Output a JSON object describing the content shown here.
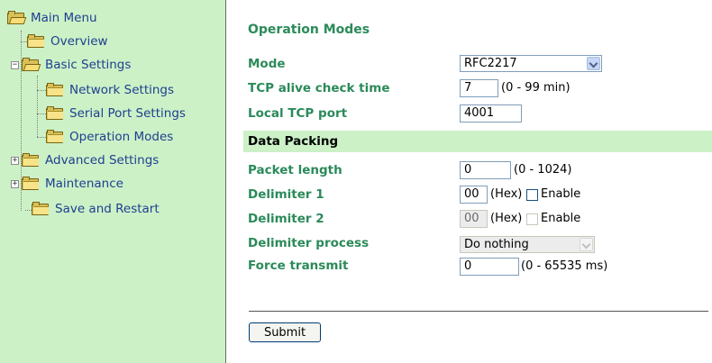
{
  "sidebar": {
    "items": [
      {
        "label": "Main Menu"
      },
      {
        "label": "Overview"
      },
      {
        "label": "Basic Settings"
      },
      {
        "label": "Network Settings"
      },
      {
        "label": "Serial Port Settings"
      },
      {
        "label": "Operation Modes"
      },
      {
        "label": "Advanced Settings"
      },
      {
        "label": "Maintenance"
      },
      {
        "label": "Save and Restart"
      }
    ]
  },
  "main": {
    "title": "Operation Modes",
    "mode": {
      "label": "Mode",
      "value": "RFC2217"
    },
    "tcp_alive": {
      "label": "TCP alive check time",
      "value": "7",
      "hint": "(0 - 99 min)"
    },
    "local_tcp_port": {
      "label": "Local TCP port",
      "value": "4001"
    },
    "data_packing": {
      "label": "Data Packing"
    },
    "packet_length": {
      "label": "Packet length",
      "value": "0",
      "hint": "(0 - 1024)"
    },
    "delimiter1": {
      "label": "Delimiter 1",
      "value": "00",
      "hint": "(Hex)",
      "enable_label": "Enable",
      "enabled": false
    },
    "delimiter2": {
      "label": "Delimiter 2",
      "value": "00",
      "hint": "(Hex)",
      "enable_label": "Enable",
      "enabled": false
    },
    "delimiter_process": {
      "label": "Delimiter process",
      "value": "Do nothing"
    },
    "force_transmit": {
      "label": "Force transmit",
      "value": "0",
      "hint": "(0 - 65535 ms)"
    },
    "submit_label": "Submit"
  },
  "colors": {
    "sidebar_bg": "#ccf1c7",
    "label_green": "#2b8a5a",
    "link_blue": "#1f3f8f"
  }
}
